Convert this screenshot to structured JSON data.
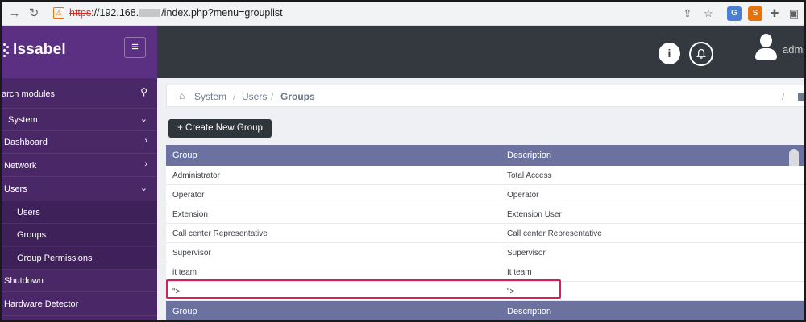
{
  "browser": {
    "back_icon": "arrow-left-icon",
    "reload_icon": "reload-icon",
    "url_scheme": "https",
    "url_host": "://192.168.",
    "url_path": "/index.php?menu=grouplist",
    "toolbar_icons": [
      "share-icon",
      "star-icon",
      "translate-extension-icon",
      "extension-orange-icon",
      "puzzle-icon",
      "sidebar-toggle-icon"
    ]
  },
  "header": {
    "logo_text": "Issabel",
    "menu_toggle_icon": "hamburger-icon",
    "info_icon": "info-icon",
    "bell_icon": "bell-icon",
    "user_name": "admi"
  },
  "sidebar": {
    "search_label": "arch modules",
    "search_icon": "search-icon",
    "items": [
      {
        "label": "System",
        "chevron": "⌄"
      },
      {
        "label": "Dashboard",
        "chevron": "›"
      },
      {
        "label": "Network",
        "chevron": "›"
      },
      {
        "label": "Users",
        "chevron": "⌄"
      },
      {
        "label": "Users",
        "chevron": ""
      },
      {
        "label": "Groups",
        "chevron": ""
      },
      {
        "label": "Group Permissions",
        "chevron": ""
      },
      {
        "label": "Shutdown",
        "chevron": ""
      },
      {
        "label": "Hardware Detector",
        "chevron": ""
      }
    ]
  },
  "breadcrumb": {
    "home_icon": "home-icon",
    "items": [
      "System",
      "Users",
      "Groups"
    ],
    "separator": "/"
  },
  "toolbar": {
    "create_label": "+ Create New Group"
  },
  "table": {
    "columns": [
      "Group",
      "Description"
    ],
    "rows": [
      {
        "group": "Administrator",
        "description": "Total Access"
      },
      {
        "group": "Operator",
        "description": "Operator"
      },
      {
        "group": "Extension",
        "description": "Extension User"
      },
      {
        "group": "Call center Representative",
        "description": "Call center Representative"
      },
      {
        "group": "Supervisor",
        "description": "Supervisor"
      },
      {
        "group": "it team",
        "description": "It team"
      },
      {
        "group": "\">",
        "description": "\">"
      }
    ],
    "footer_columns": [
      "Group",
      "Description"
    ]
  },
  "colors": {
    "sidebar": "#4a2868",
    "topbar": "#33393f",
    "table_header": "#6c72a0",
    "highlight": "#d81e5b"
  }
}
